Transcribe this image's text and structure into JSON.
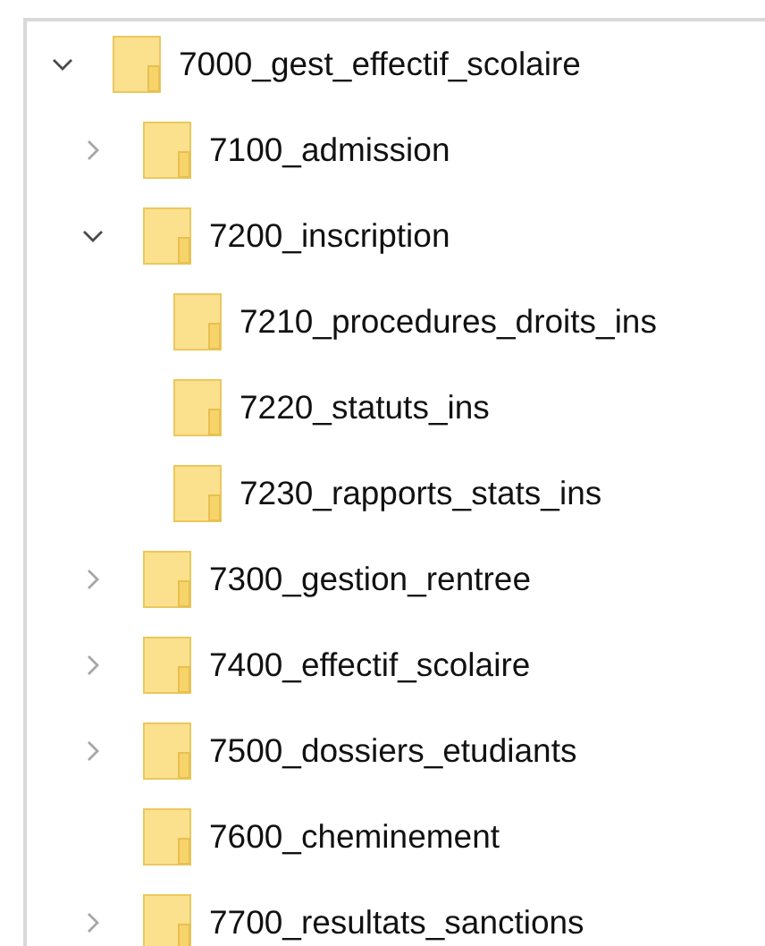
{
  "tree": [
    {
      "label": "7000_gest_effectif_scolaire",
      "kind": "branch",
      "expanded": true,
      "children": [
        {
          "label": "7100_admission",
          "kind": "branch",
          "expanded": false
        },
        {
          "label": "7200_inscription",
          "kind": "branch",
          "expanded": true,
          "children": [
            {
              "label": "7210_procedures_droits_ins",
              "kind": "leaf"
            },
            {
              "label": "7220_statuts_ins",
              "kind": "leaf"
            },
            {
              "label": "7230_rapports_stats_ins",
              "kind": "leaf"
            }
          ]
        },
        {
          "label": "7300_gestion_rentree",
          "kind": "branch",
          "expanded": false
        },
        {
          "label": "7400_effectif_scolaire",
          "kind": "branch",
          "expanded": false
        },
        {
          "label": "7500_dossiers_etudiants",
          "kind": "branch",
          "expanded": false
        },
        {
          "label": "7600_cheminement",
          "kind": "leaf"
        },
        {
          "label": "7700_resultats_sanctions",
          "kind": "branch",
          "expanded": false
        }
      ]
    }
  ]
}
